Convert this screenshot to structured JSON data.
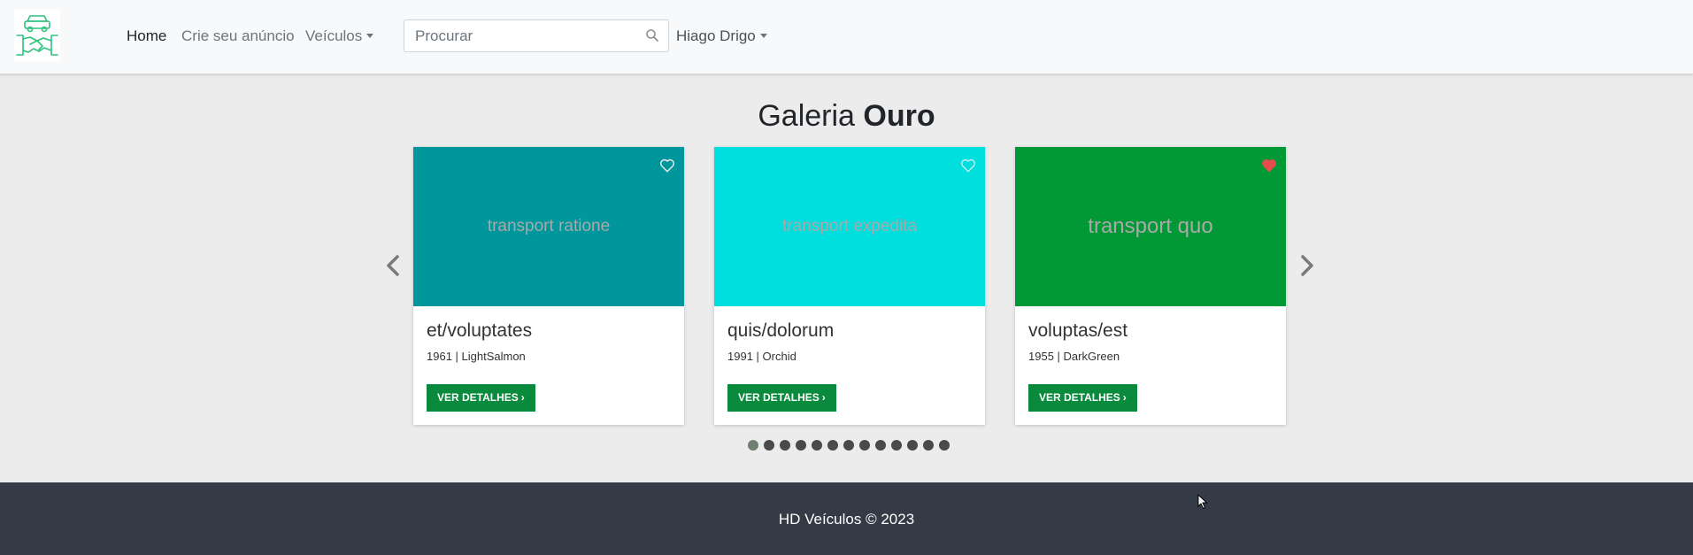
{
  "brand": {
    "logo_icon": "car-handshake-logo-icon",
    "color": "#2ec27e"
  },
  "nav": {
    "home": "Home",
    "create_ad": "Crie seu anúncio",
    "vehicles": "Veículos"
  },
  "search": {
    "placeholder": "Procurar",
    "value": ""
  },
  "user": {
    "name": "Hiago Drigo"
  },
  "gallery": {
    "title_regular": "Galeria ",
    "title_bold": "Ouro",
    "cards": [
      {
        "image_text": "transport ratione",
        "image_color": "#00979c",
        "title": "et/voluptates",
        "subtitle": "1961 | LightSalmon",
        "button": "VER DETALHES",
        "favorited": false
      },
      {
        "image_text": "transport expedita",
        "image_color": "#00dede",
        "title": "quis/dolorum",
        "subtitle": "1991 | Orchid",
        "button": "VER DETALHES",
        "favorited": false
      },
      {
        "image_text": "transport quo",
        "image_color": "#009936",
        "title": "voluptas/est",
        "subtitle": "1955 | DarkGreen",
        "button": "VER DETALHES",
        "favorited": true
      }
    ],
    "page_count": 13,
    "active_page": 1
  },
  "colors": {
    "button": "#0a8a3c",
    "heart_active": "#e74c4c",
    "footer": "#343a46"
  },
  "footer": {
    "text": "HD Veículos © 2023"
  }
}
